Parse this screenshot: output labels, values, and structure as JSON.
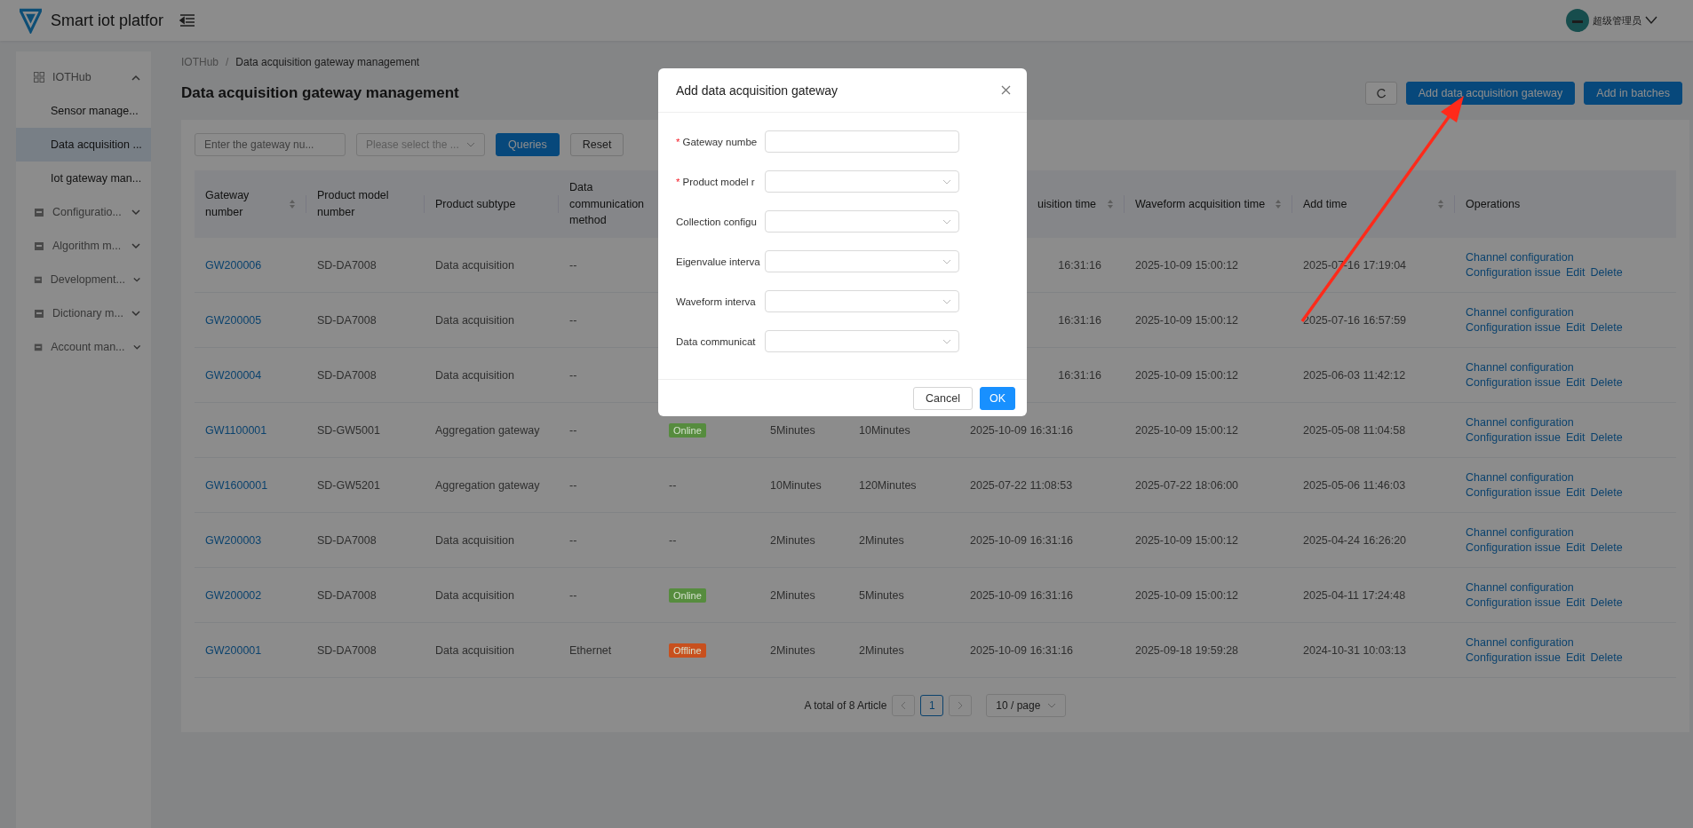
{
  "header": {
    "title": "Smart iot platfor",
    "user": "超级管理员"
  },
  "sidebar": {
    "items": [
      {
        "label": "IOTHub",
        "expanded": true,
        "children": [
          {
            "label": "Sensor manage...",
            "selected": false
          },
          {
            "label": "Data acquisition ...",
            "selected": true
          },
          {
            "label": "Iot gateway man...",
            "selected": false
          }
        ]
      },
      {
        "label": "Configuratio...",
        "expanded": false
      },
      {
        "label": "Algorithm m...",
        "expanded": false
      },
      {
        "label": "Development...",
        "expanded": false
      },
      {
        "label": "Dictionary m...",
        "expanded": false
      },
      {
        "label": "Account man...",
        "expanded": false
      }
    ]
  },
  "breadcrumb": {
    "items": [
      "IOTHub",
      "Data acquisition gateway management"
    ],
    "separator": "/"
  },
  "page_title": "Data acquisition gateway management",
  "actions": [
    "Add data acquisition gateway",
    "Add in batches"
  ],
  "filters": {
    "gateway_placeholder": "Enter the gateway nu...",
    "select_placeholder": "Please select the ...",
    "query": "Queries",
    "reset": "Reset"
  },
  "table": {
    "columns": [
      {
        "label": "Gateway number",
        "sortable": true
      },
      {
        "label": "Product model number",
        "sortable": false
      },
      {
        "label": "Product subtype",
        "sortable": false
      },
      {
        "label": "Data communication method",
        "sortable": false
      },
      {
        "label": "uisition time",
        "sortable": true
      },
      {
        "label": "Waveform acquisition time",
        "sortable": true
      },
      {
        "label": "Add time",
        "sortable": true
      },
      {
        "label": "Operations",
        "sortable": false
      }
    ],
    "rows": [
      {
        "gateway": "GW200006",
        "model": "SD-DA7008",
        "subtype": "Data acquisition",
        "comm": "--",
        "eig_time": "16:31:16",
        "wave_time": "2025-10-09 15:00:12",
        "add_time": "2025-07-16 17:19:04"
      },
      {
        "gateway": "GW200005",
        "model": "SD-DA7008",
        "subtype": "Data acquisition",
        "comm": "--",
        "eig_time": "16:31:16",
        "wave_time": "2025-10-09 15:00:12",
        "add_time": "2025-07-16 16:57:59"
      },
      {
        "gateway": "GW200004",
        "model": "SD-DA7008",
        "subtype": "Data acquisition",
        "comm": "--",
        "eig_time": "16:31:16",
        "wave_time": "2025-10-09 15:00:12",
        "add_time": "2025-06-03 11:42:12"
      },
      {
        "gateway": "GW1100001",
        "model": "SD-GW5001",
        "subtype": "Aggregation gateway",
        "comm": "--",
        "status": {
          "kind": "tag",
          "label": "Online",
          "color": "#568c3e"
        },
        "eig_interval": "5Minutes",
        "wave_interval": "10Minutes",
        "eig_time": "2025-10-09 16:31:16",
        "wave_time": "2025-10-09 15:00:12",
        "add_time": "2025-05-08 11:04:58"
      },
      {
        "gateway": "GW1600001",
        "model": "SD-GW5201",
        "subtype": "Aggregation gateway",
        "comm": "--",
        "status": {
          "kind": "text",
          "label": "--"
        },
        "eig_interval": "10Minutes",
        "wave_interval": "120Minutes",
        "eig_time": "2025-07-22 11:08:53",
        "wave_time": "2025-07-22 18:06:00",
        "add_time": "2025-05-06 11:46:03"
      },
      {
        "gateway": "GW200003",
        "model": "SD-DA7008",
        "subtype": "Data acquisition",
        "comm": "--",
        "status": {
          "kind": "text",
          "label": "--"
        },
        "eig_interval": "2Minutes",
        "wave_interval": "2Minutes",
        "eig_time": "2025-10-09 16:31:16",
        "wave_time": "2025-10-09 15:00:12",
        "add_time": "2025-04-24 16:26:20"
      },
      {
        "gateway": "GW200002",
        "model": "SD-DA7008",
        "subtype": "Data acquisition",
        "comm": "--",
        "status": {
          "kind": "tag",
          "label": "Online",
          "color": "#568c3e"
        },
        "eig_interval": "2Minutes",
        "wave_interval": "5Minutes",
        "eig_time": "2025-10-09 16:31:16",
        "wave_time": "2025-10-09 15:00:12",
        "add_time": "2025-04-11 17:24:48"
      },
      {
        "gateway": "GW200001",
        "model": "SD-DA7008",
        "subtype": "Data acquisition",
        "comm": "Ethernet",
        "status": {
          "kind": "tag",
          "label": "Offline",
          "color": "#c8501e"
        },
        "eig_interval": "2Minutes",
        "wave_interval": "2Minutes",
        "eig_time": "2025-10-09 16:31:16",
        "wave_time": "2025-09-18 19:59:28",
        "add_time": "2024-10-31 10:03:13"
      }
    ],
    "row_operations": [
      [
        "Channel configuration",
        "Configuration issue",
        "Edit",
        "Delete"
      ],
      [
        "Channel configuration",
        "Configuration issue",
        "Edit",
        "Delete"
      ],
      [
        "Channel configuration",
        "Configuration issue",
        "Edit",
        "Delete"
      ],
      [
        "Channel configuration",
        "Configuration issue",
        "Edit",
        "Delete"
      ],
      [
        "Channel configuration",
        "Configuration issue",
        "Edit",
        "Delete"
      ],
      [
        "Channel configuration",
        "Configuration issue",
        "Edit",
        "Delete"
      ],
      [
        "Channel configuration",
        "Configuration issue",
        "Edit",
        "Delete"
      ],
      [
        "Channel configuration",
        "Configuration issue",
        "Edit",
        "Delete"
      ]
    ]
  },
  "pagination": {
    "total": "A total of 8 Article",
    "pages": [
      {
        "label": "1",
        "selected": true
      }
    ],
    "page_size": "10 / page"
  },
  "dialog": {
    "title": "Add data acquisition gateway",
    "fields": [
      {
        "required_mark": "*",
        "label": "Gateway numbe",
        "kind": "input"
      },
      {
        "required_mark": "*",
        "label": "Product model r",
        "kind": "select"
      },
      {
        "label": "Collection configu",
        "kind": "select"
      },
      {
        "label": "Eigenvalue interva",
        "kind": "select"
      },
      {
        "label": "Waveform interva",
        "kind": "select"
      },
      {
        "label": "Data communicat",
        "kind": "select"
      }
    ],
    "cancel": "Cancel",
    "ok": "OK"
  },
  "annotation": {
    "kind": "arrow"
  }
}
